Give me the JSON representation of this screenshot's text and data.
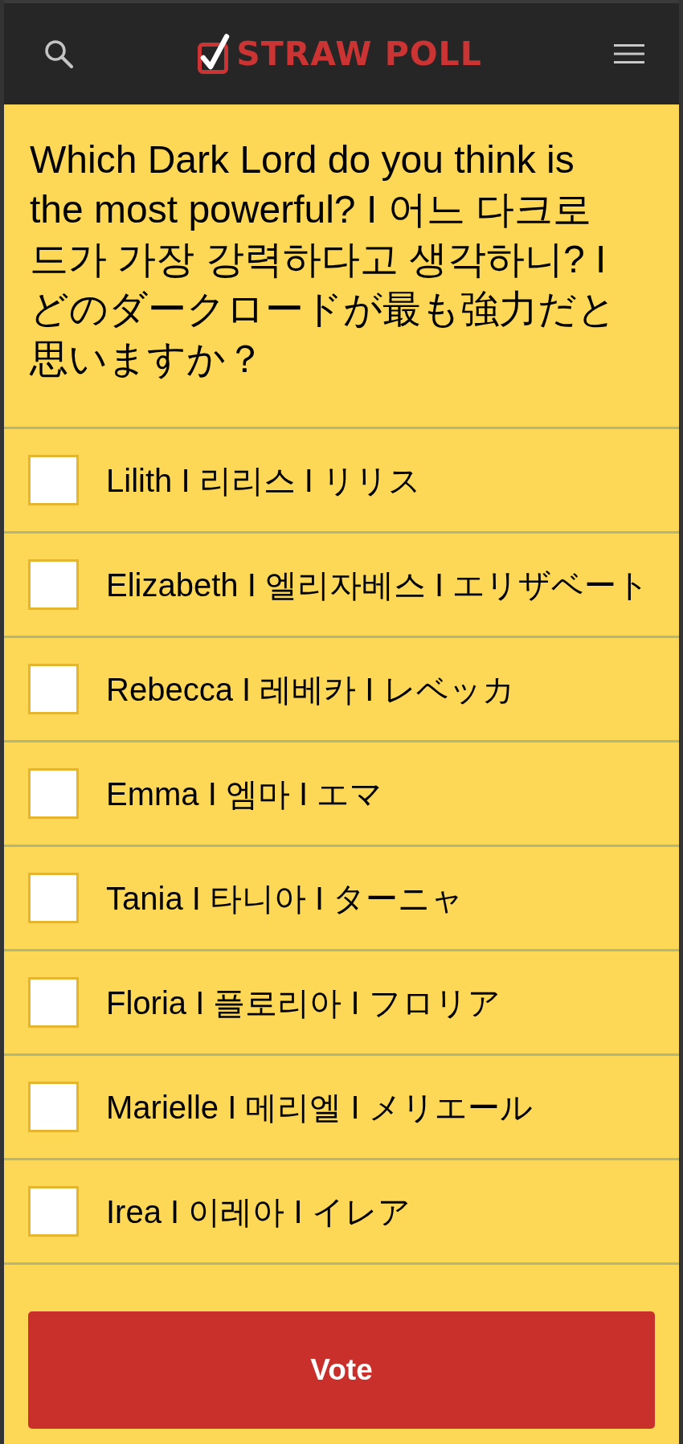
{
  "header": {
    "logo_text": "STRAW POLL"
  },
  "poll": {
    "question": "Which Dark Lord do you think is the most powerful? I 어느 다크로드가 가장 강력하다고 생각하니? I どのダークロードが最も強力だと思いますか？",
    "options": [
      {
        "label": "Lilith I 리리스 I リリス",
        "checked": false
      },
      {
        "label": "Elizabeth I 엘리자베스 I エリザベート",
        "checked": false
      },
      {
        "label": "Rebecca I 레베카 I レベッカ",
        "checked": false
      },
      {
        "label": "Emma I 엠마 I エマ",
        "checked": false
      },
      {
        "label": "Tania I 타니아 I ターニャ",
        "checked": false
      },
      {
        "label": "Floria I 플로리아 I フロリア",
        "checked": false
      },
      {
        "label": "Marielle I 메리엘 I メリエール",
        "checked": false
      },
      {
        "label": "Irea I 이레아 I イレア",
        "checked": false
      }
    ]
  },
  "vote_button": {
    "label": "Vote"
  }
}
